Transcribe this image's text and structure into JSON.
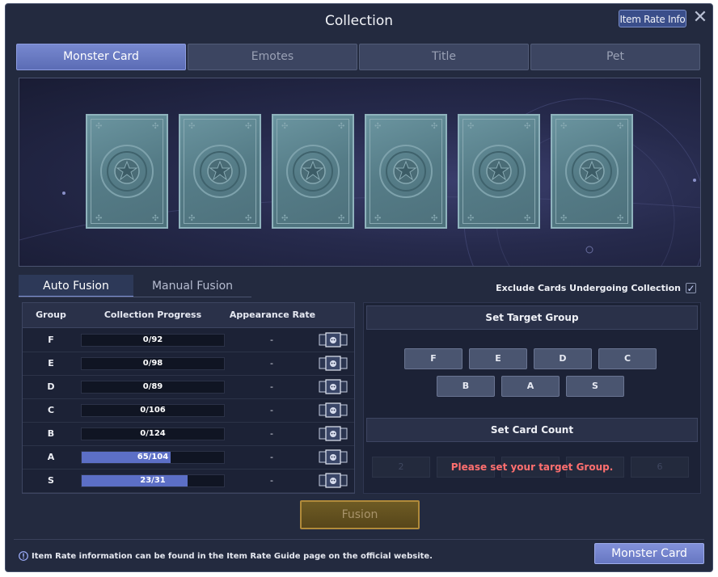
{
  "window": {
    "title": "Collection",
    "item_rate_info_label": "Item Rate Info",
    "close_glyph": "✕"
  },
  "main_tabs": [
    {
      "label": "Monster Card",
      "active": true
    },
    {
      "label": "Emotes",
      "active": false
    },
    {
      "label": "Title",
      "active": false
    },
    {
      "label": "Pet",
      "active": false
    }
  ],
  "cards": {
    "count": 6,
    "state": "face-down"
  },
  "sub_tabs": [
    {
      "label": "Auto Fusion",
      "active": true
    },
    {
      "label": "Manual Fusion",
      "active": false
    }
  ],
  "exclude_option": {
    "label": "Exclude Cards Undergoing Collection",
    "checked": true
  },
  "table": {
    "headers": {
      "group": "Group",
      "progress": "Collection Progress",
      "rate": "Appearance Rate"
    },
    "rows": [
      {
        "group": "F",
        "progress": "0/92",
        "fraction": 0,
        "rate": "-"
      },
      {
        "group": "E",
        "progress": "0/98",
        "fraction": 0,
        "rate": "-"
      },
      {
        "group": "D",
        "progress": "0/89",
        "fraction": 0,
        "rate": "-"
      },
      {
        "group": "C",
        "progress": "0/106",
        "fraction": 0,
        "rate": "-"
      },
      {
        "group": "B",
        "progress": "0/124",
        "fraction": 0,
        "rate": "-"
      },
      {
        "group": "A",
        "progress": "65/104",
        "fraction": 0.625,
        "rate": "-"
      },
      {
        "group": "S",
        "progress": "23/31",
        "fraction": 0.742,
        "rate": "-"
      }
    ]
  },
  "target_group": {
    "title": "Set Target Group",
    "buttons": [
      "F",
      "E",
      "D",
      "C",
      "B",
      "A",
      "S"
    ]
  },
  "card_count": {
    "title": "Set Card Count",
    "buttons": [
      "2",
      "",
      "",
      "",
      "6"
    ],
    "message": "Please set your target Group."
  },
  "fusion_button": "Fusion",
  "footer": {
    "info_text": "Item Rate information can be found in the Item Rate Guide page on the official website.",
    "button": "Monster Card"
  },
  "colors": {
    "accent": "#6a7bc9",
    "fusion": "#6e5b24",
    "warning": "#ff6f6f",
    "window_bg": "#232a3f"
  }
}
